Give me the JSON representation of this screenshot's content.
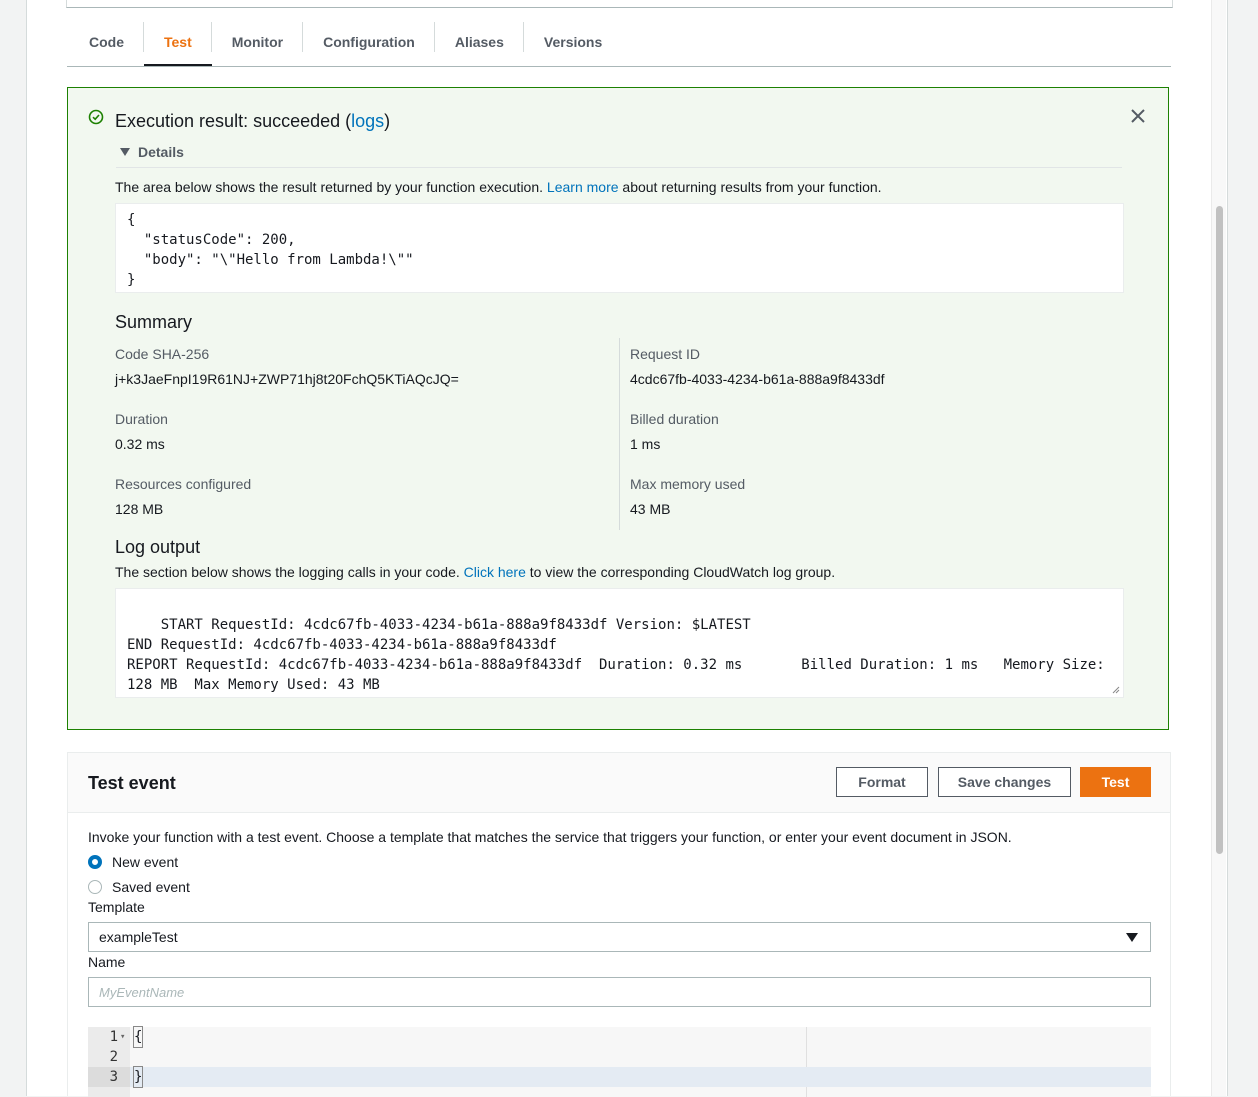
{
  "tabs": [
    {
      "label": "Code"
    },
    {
      "label": "Test"
    },
    {
      "label": "Monitor"
    },
    {
      "label": "Configuration"
    },
    {
      "label": "Aliases"
    },
    {
      "label": "Versions"
    }
  ],
  "active_tab": "Test",
  "result": {
    "title_prefix": "Execution result: succeeded (",
    "logs_link": "logs",
    "title_suffix": ")",
    "details_label": "Details",
    "desc_before": "The area below shows the result returned by your function execution. ",
    "desc_link": "Learn more",
    "desc_after": " about returning results from your function.",
    "output": "{\n  \"statusCode\": 200,\n  \"body\": \"\\\"Hello from Lambda!\\\"\"\n}",
    "summary_title": "Summary",
    "summary_left": [
      {
        "label": "Code SHA-256",
        "value": "j+k3JaeFnpI19R61NJ+ZWP71hj8t20FchQ5KTiAQcJQ="
      },
      {
        "label": "Duration",
        "value": "0.32 ms"
      },
      {
        "label": "Resources configured",
        "value": "128 MB"
      }
    ],
    "summary_right": [
      {
        "label": "Request ID",
        "value": "4cdc67fb-4033-4234-b61a-888a9f8433df"
      },
      {
        "label": "Billed duration",
        "value": "1 ms"
      },
      {
        "label": "Max memory used",
        "value": "43 MB"
      }
    ],
    "log_title": "Log output",
    "log_desc_before": "The section below shows the logging calls in your code. ",
    "log_desc_link": "Click here",
    "log_desc_after": " to view the corresponding CloudWatch log group.",
    "log_text": "START RequestId: 4cdc67fb-4033-4234-b61a-888a9f8433df Version: $LATEST\nEND RequestId: 4cdc67fb-4033-4234-b61a-888a9f8433df\nREPORT RequestId: 4cdc67fb-4033-4234-b61a-888a9f8433df  Duration: 0.32 ms       Billed Duration: 1 ms   Memory Size: 128 MB  Max Memory Used: 43 MB"
  },
  "test_event": {
    "title": "Test event",
    "format_label": "Format",
    "save_label": "Save changes",
    "test_label": "Test",
    "description": "Invoke your function with a test event. Choose a template that matches the service that triggers your function, or enter your event document in JSON.",
    "radio_new": "New event",
    "radio_saved": "Saved event",
    "selected_radio": "New event",
    "template_label": "Template",
    "template_value": "exampleTest",
    "name_label": "Name",
    "name_placeholder": "MyEventName",
    "editor_lines": [
      {
        "num": "1",
        "text": "{"
      },
      {
        "num": "2",
        "text": ""
      },
      {
        "num": "3",
        "text": "}"
      }
    ]
  },
  "colors": {
    "accent": "#ec7211",
    "link": "#0073bb",
    "success": "#1d8102",
    "success_bg": "#f2f8f0"
  },
  "icons": {
    "success": "check-circle-icon",
    "close": "close-icon",
    "details_toggle": "caret-down-icon",
    "template_dropdown": "caret-down-icon"
  }
}
